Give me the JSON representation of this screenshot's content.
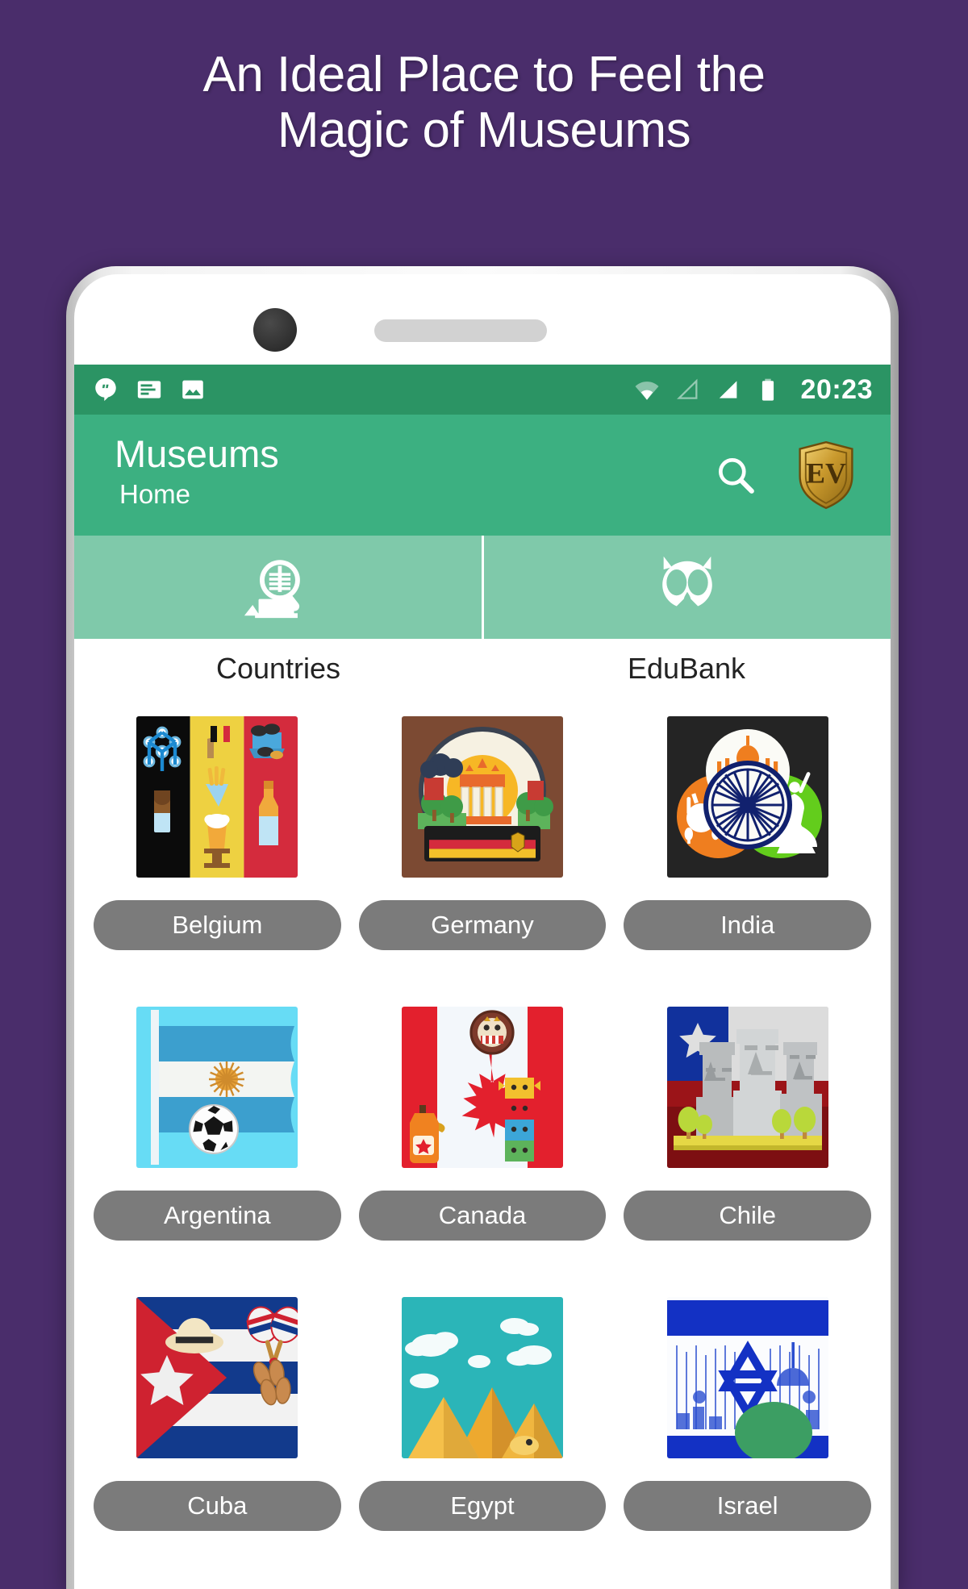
{
  "promo": {
    "line1": "An Ideal Place to Feel the",
    "line2": "Magic of Museums",
    "background_color": "#4a2d6b"
  },
  "device": {
    "frame_color": "#e9e9e9",
    "camera_icon": "camera-dot",
    "speaker_icon": "speaker-grill"
  },
  "status_bar": {
    "background_color": "#2b9464",
    "left_icons": [
      "hangouts-icon",
      "message-card-icon",
      "photo-icon"
    ],
    "right_icons": [
      "wifi-icon",
      "signal-empty-icon",
      "signal-full-icon",
      "battery-icon"
    ],
    "clock": "20:23"
  },
  "app_bar": {
    "background_color": "#3cb081",
    "title": "Museums",
    "subtitle": "Home",
    "search_icon": "search-icon",
    "logo_text": "EV",
    "logo_icon": "ev-shield-logo"
  },
  "tabs": {
    "background_color": "#7fc9aa",
    "items": [
      {
        "label": "Countries",
        "icon": "museum-search-icon",
        "selected": true
      },
      {
        "label": "EduBank",
        "icon": "owl-icon",
        "selected": false
      }
    ]
  },
  "grid": {
    "pill_color": "#7b7b7b",
    "rows": [
      [
        {
          "label": "Belgium",
          "image": "belgium-flag-collage"
        },
        {
          "label": "Germany",
          "image": "germany-brandenburg-gate"
        },
        {
          "label": "India",
          "image": "india-circles-collage"
        }
      ],
      [
        {
          "label": "Argentina",
          "image": "argentina-flag-soccer"
        },
        {
          "label": "Canada",
          "image": "canada-flag-maple"
        },
        {
          "label": "Chile",
          "image": "chile-moai-statues"
        }
      ],
      [
        {
          "label": "Cuba",
          "image": "cuba-flag-hat-maracas"
        },
        {
          "label": "Egypt",
          "image": "egypt-pyramids"
        },
        {
          "label": "Israel",
          "image": "israel-flag-star"
        }
      ]
    ]
  }
}
